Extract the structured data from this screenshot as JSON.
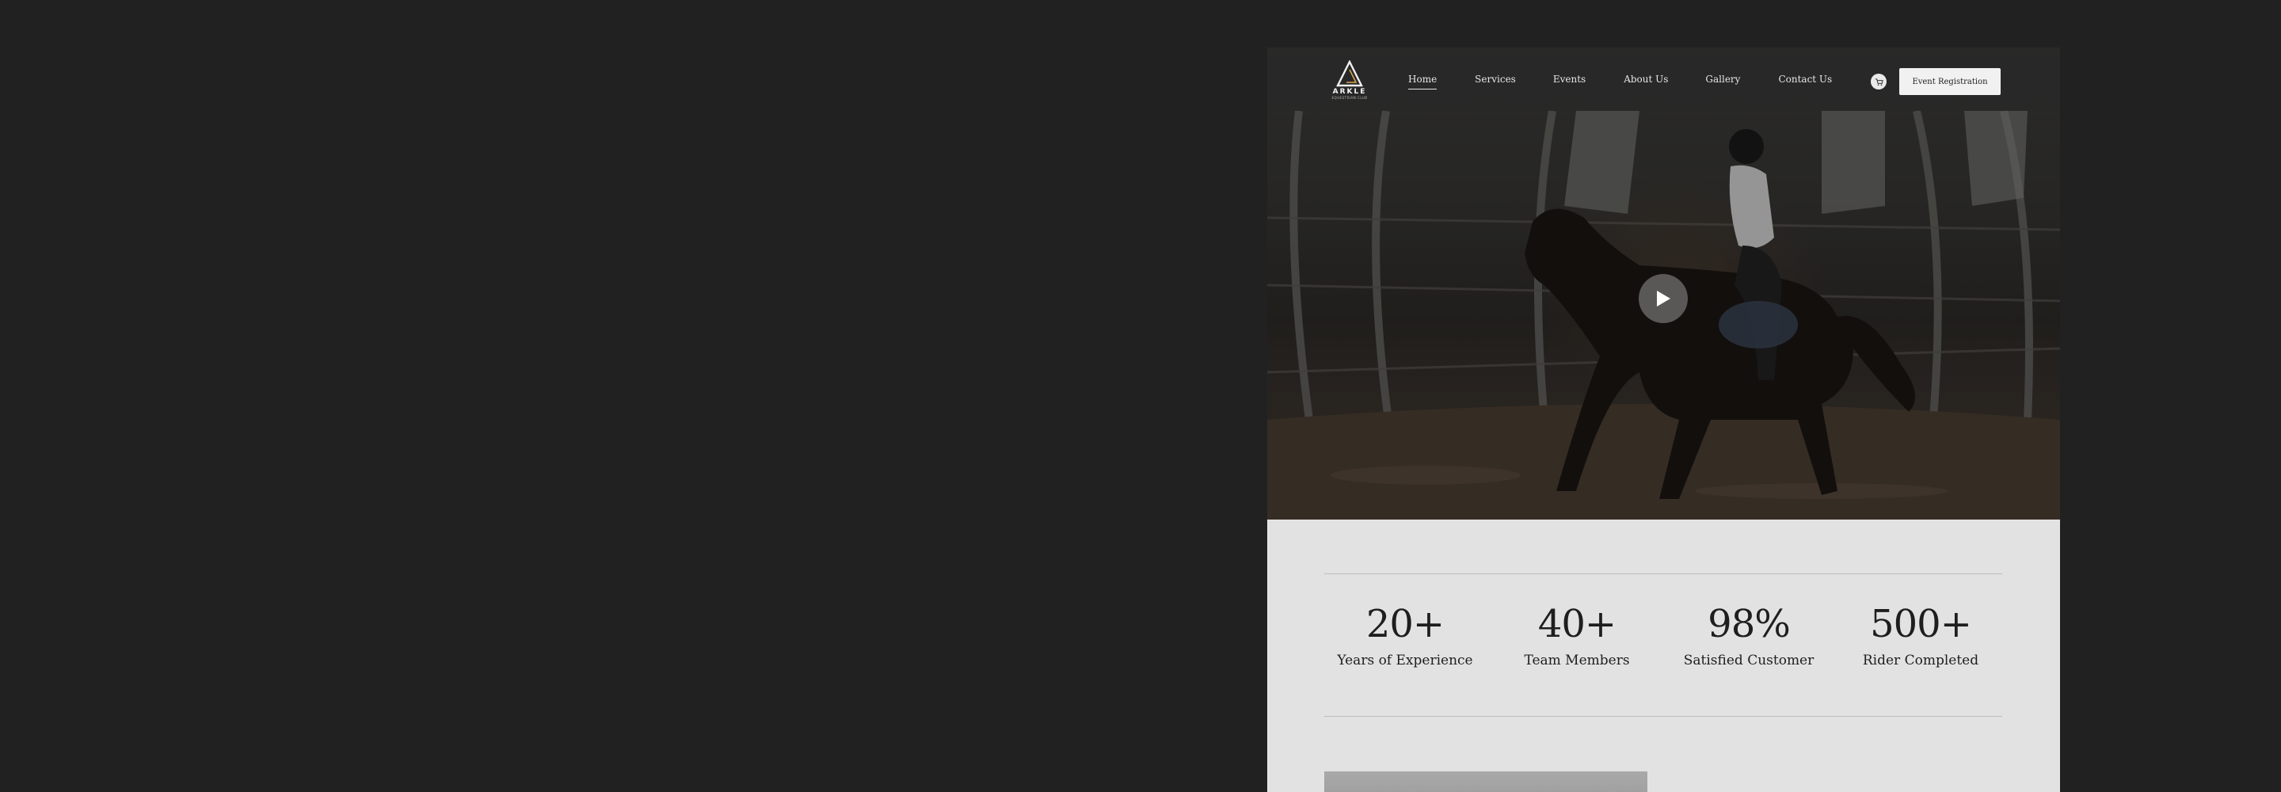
{
  "brand": {
    "name": "ARKLE",
    "tagline": "EQUESTRIAN CLUB"
  },
  "nav": {
    "links": [
      {
        "label": "Home",
        "active": true
      },
      {
        "label": "Services",
        "active": false
      },
      {
        "label": "Events",
        "active": false
      },
      {
        "label": "About Us",
        "active": false
      },
      {
        "label": "Gallery",
        "active": false
      },
      {
        "label": "Contact Us",
        "active": false
      }
    ],
    "cart_icon": "cart-icon",
    "cta_label": "Event Registration"
  },
  "hero": {
    "play_icon": "play-icon"
  },
  "stats": [
    {
      "value": "20+",
      "label": "Years of Experience"
    },
    {
      "value": "40+",
      "label": "Team Members"
    },
    {
      "value": "98%",
      "label": "Satisfied Customer"
    },
    {
      "value": "500+",
      "label": "Rider Completed"
    }
  ],
  "colors": {
    "page_background": "#212121",
    "content_background": "#e2e2e2",
    "text": "#1e1e1e"
  }
}
